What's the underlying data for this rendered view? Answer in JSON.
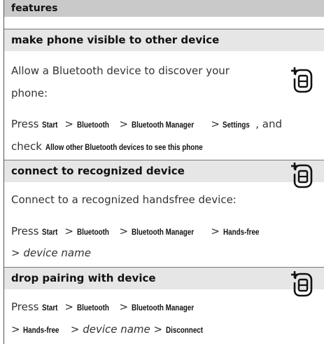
{
  "header": {
    "title": "features"
  },
  "sections": [
    {
      "title": "make phone visible to other device",
      "intro_line1": "Allow a Bluetooth device to discover your",
      "intro_line2": "phone:",
      "press": "Press",
      "path": [
        "Start",
        "Bluetooth",
        "Bluetooth Manager",
        "Settings"
      ],
      "and": ", and",
      "check": "check",
      "check_item": "Allow other Bluetooth devices to see this phone"
    },
    {
      "title": "connect to recognized device",
      "intro": "Connect to a recognized handsfree device:",
      "press": "Press",
      "path": [
        "Start",
        "Bluetooth",
        "Bluetooth Manager",
        "Hands-free"
      ],
      "device": "device name"
    },
    {
      "title": "drop pairing with device",
      "press": "Press",
      "path": [
        "Start",
        "Bluetooth",
        "Bluetooth Manager"
      ],
      "path2": [
        "Hands-free"
      ],
      "device": "device name",
      "end": "Disconnect"
    }
  ],
  "sep": ">",
  "icon_name": "phone-feature-icon"
}
